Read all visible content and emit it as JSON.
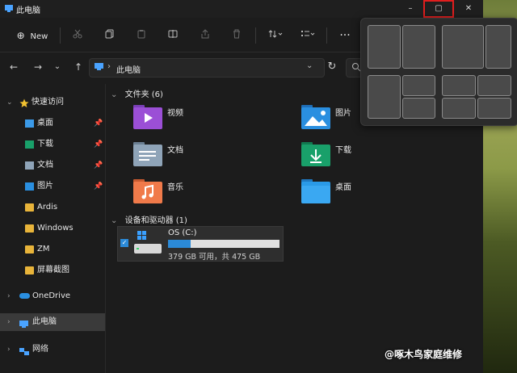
{
  "window": {
    "title": "此电脑"
  },
  "titlebar_buttons": {
    "minimize": "–",
    "maximize": "▢",
    "close": "✕"
  },
  "toolbar": {
    "new_label": "New",
    "new_icon": "⊕",
    "more": "···"
  },
  "address": {
    "location": "此电脑",
    "dropdown": "⌄",
    "refresh": "↻"
  },
  "nav": {
    "back": "←",
    "forward": "→",
    "history": "⌄",
    "up": "↑"
  },
  "sidebar": {
    "quick_access": "快速访问",
    "items": [
      {
        "label": "桌面",
        "pinned": true
      },
      {
        "label": "下载",
        "pinned": true
      },
      {
        "label": "文档",
        "pinned": true
      },
      {
        "label": "图片",
        "pinned": true
      },
      {
        "label": "Ardis",
        "pinned": false
      },
      {
        "label": "Windows",
        "pinned": false
      },
      {
        "label": "ZM",
        "pinned": false
      },
      {
        "label": "屏幕截图",
        "pinned": false
      }
    ],
    "onedrive": "OneDrive",
    "this_pc": "此电脑",
    "network": "网络"
  },
  "content": {
    "folders_header": "文件夹 (6)",
    "folders": [
      {
        "label": "视频",
        "color": "#9b4fd6"
      },
      {
        "label": "图片",
        "color": "#2a8fe0"
      },
      {
        "label": "文档",
        "color": "#8fa4b8"
      },
      {
        "label": "下载",
        "color": "#19a06a"
      },
      {
        "label": "音乐",
        "color": "#f07a4a"
      },
      {
        "label": "桌面",
        "color": "#2a9ae8"
      }
    ],
    "devices_header": "设备和驱动器 (1)",
    "drive": {
      "name": "OS (C:)",
      "info": "379 GB 可用，共 475 GB",
      "used_fraction": 0.2
    }
  },
  "watermark": "@啄木鸟家庭维修",
  "accent": "#e01e1e"
}
